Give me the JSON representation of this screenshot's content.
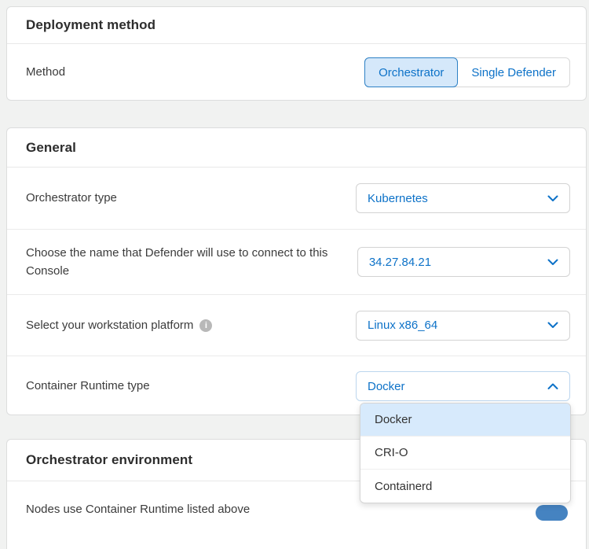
{
  "colors": {
    "accent_blue": "#0d72c8",
    "selected_segment_bg": "#d5e8fa",
    "selected_segment_border": "#2e81c5",
    "menu_highlight_bg": "#d7eafc",
    "toggle_on_blue": "#4583c1",
    "page_background": "#f1f2f1"
  },
  "icons": {
    "chevron_down": "chevron-down-icon",
    "chevron_up": "chevron-up-icon",
    "info": "info-icon",
    "info_glyph": "i"
  },
  "deployment_method": {
    "title": "Deployment method",
    "method_label": "Method",
    "options": [
      {
        "label": "Orchestrator",
        "selected": true
      },
      {
        "label": "Single Defender",
        "selected": false
      }
    ]
  },
  "general": {
    "title": "General",
    "rows": [
      {
        "label": "Orchestrator type",
        "value": "Kubernetes",
        "state": "closed"
      },
      {
        "label": "Choose the name that Defender will use to connect to this Console",
        "value": "34.27.84.21",
        "state": "closed"
      },
      {
        "label": "Select your workstation platform",
        "value": "Linux x86_64",
        "state": "closed",
        "has_info_icon": true
      },
      {
        "label": "Container Runtime type",
        "value": "Docker",
        "state": "open"
      }
    ]
  },
  "runtime_menu": {
    "options": [
      {
        "label": "Docker",
        "highlighted": true
      },
      {
        "label": "CRI-O",
        "highlighted": false
      },
      {
        "label": "Containerd",
        "highlighted": false
      }
    ]
  },
  "orchestrator_environment": {
    "title": "Orchestrator environment",
    "partial_row": {
      "label": "Nodes use Container Runtime listed above",
      "toggle_state": "on"
    }
  }
}
